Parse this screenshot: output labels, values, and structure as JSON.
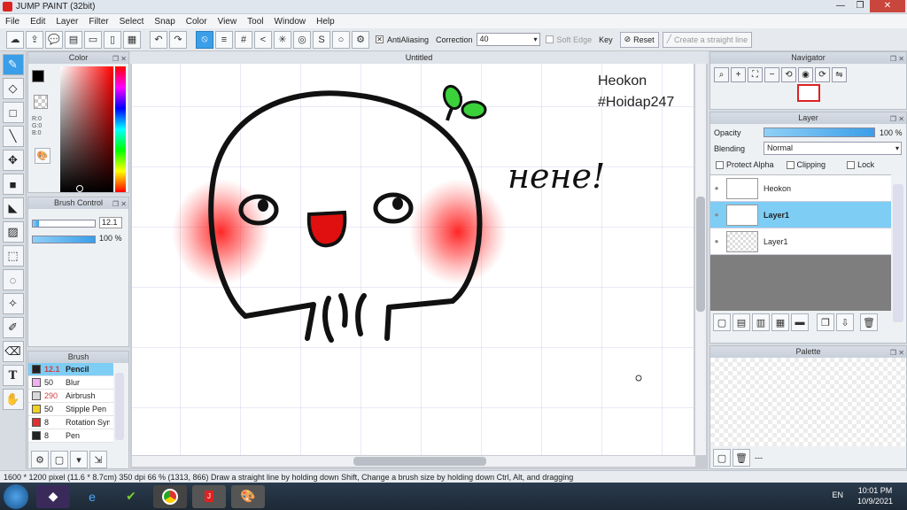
{
  "app": {
    "title": "JUMP PAINT (32bit)",
    "window_controls": [
      "—",
      "❐",
      "✕"
    ]
  },
  "menu": [
    "File",
    "Edit",
    "Layer",
    "Filter",
    "Select",
    "Snap",
    "Color",
    "View",
    "Tool",
    "Window",
    "Help"
  ],
  "toolbar": {
    "antialiasing_label": "AntiAliasing",
    "correction_label": "Correction",
    "correction_value": "40",
    "soft_edge_label": "Soft Edge",
    "key_label": "Key",
    "reset_label": "Reset",
    "straight_line_label": "Create a straight line"
  },
  "color_panel": {
    "title": "Color",
    "rgb": [
      "R:0",
      "G:0",
      "B:0"
    ]
  },
  "brush_control": {
    "title": "Brush Control",
    "size": "12.1",
    "opacity": "100 %",
    "size_fraction": 0.1,
    "opacity_fraction": 1.0
  },
  "brush_panel": {
    "title": "Brush",
    "items": [
      {
        "size": "12.1",
        "name": "Pencil",
        "color": "#222222",
        "size_color": "#d04040"
      },
      {
        "size": "50",
        "name": "Blur",
        "color": "#f0b0f0",
        "size_color": "#222222"
      },
      {
        "size": "290",
        "name": "Airbrush",
        "color": "#d8d8d8",
        "size_color": "#d04040"
      },
      {
        "size": "50",
        "name": "Stipple Pen",
        "color": "#f0d020",
        "size_color": "#222222"
      },
      {
        "size": "8",
        "name": "Rotation Symm",
        "color": "#e03030",
        "size_color": "#222222"
      },
      {
        "size": "8",
        "name": "Pen",
        "color": "#222222",
        "size_color": "#222222"
      }
    ]
  },
  "document": {
    "tab": "Untitled",
    "signature_name": "Heokon",
    "signature_tag": "#Hoidap247",
    "handwritten": "нене!"
  },
  "navigator": {
    "title": "Navigator"
  },
  "layer_panel": {
    "title": "Layer",
    "opacity_label": "Opacity",
    "opacity_value": "100 %",
    "blending_label": "Blending",
    "blending_value": "Normal",
    "protect_alpha": "Protect Alpha",
    "clipping": "Clipping",
    "lock": "Lock",
    "layers": [
      {
        "name": "Heokon",
        "selected": false
      },
      {
        "name": "Layer1",
        "selected": true
      },
      {
        "name": "Layer1",
        "selected": false
      }
    ]
  },
  "palette": {
    "title": "Palette",
    "footer": "---"
  },
  "status": "1600 * 1200 pixel  (11.6 * 8.7cm)  350 dpi  66 %  (1313, 866)  Draw a straight line by holding down Shift, Change a brush size by holding down Ctrl, Alt, and dragging",
  "taskbar": {
    "lang": "EN",
    "time": "10:01 PM",
    "date": "10/9/2021"
  },
  "colors": {
    "accent": "#3b9ee8",
    "selected_row": "#7ecdf5",
    "taskbar": "#1d2935"
  }
}
